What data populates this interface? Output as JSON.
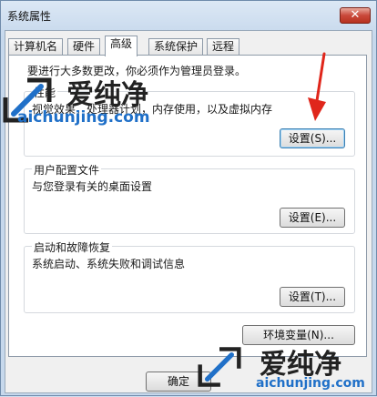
{
  "window": {
    "title": "系统属性",
    "close_glyph": "✕"
  },
  "tabs": [
    {
      "label": "计算机名",
      "active": false
    },
    {
      "label": "硬件",
      "active": false
    },
    {
      "label": "高级",
      "active": true
    },
    {
      "label": "系统保护",
      "active": false
    },
    {
      "label": "远程",
      "active": false
    }
  ],
  "advanced": {
    "admin_note": "要进行大多数更改，你必须作为管理员登录。",
    "performance": {
      "title": "性能",
      "description": "视觉效果，处理器计划，内存使用，以及虚拟内存",
      "button": "设置(S)..."
    },
    "user_profiles": {
      "title": "用户配置文件",
      "description": "与您登录有关的桌面设置",
      "button": "设置(E)..."
    },
    "startup_recovery": {
      "title": "启动和故障恢复",
      "description": "系统启动、系统失败和调试信息",
      "button": "设置(T)..."
    },
    "env_button": "环境变量(N)..."
  },
  "footer": {
    "ok_button": "确定"
  },
  "watermark": {
    "brand": "爱纯净",
    "url": "aichunjing.com"
  },
  "colors": {
    "arrow": "#e0261b",
    "url": "#2070c8",
    "close_button": "#c9483a"
  },
  "icons": {
    "close": "close-icon",
    "arrow": "red-arrow-icon",
    "logo": "watermark-logo-icon"
  }
}
